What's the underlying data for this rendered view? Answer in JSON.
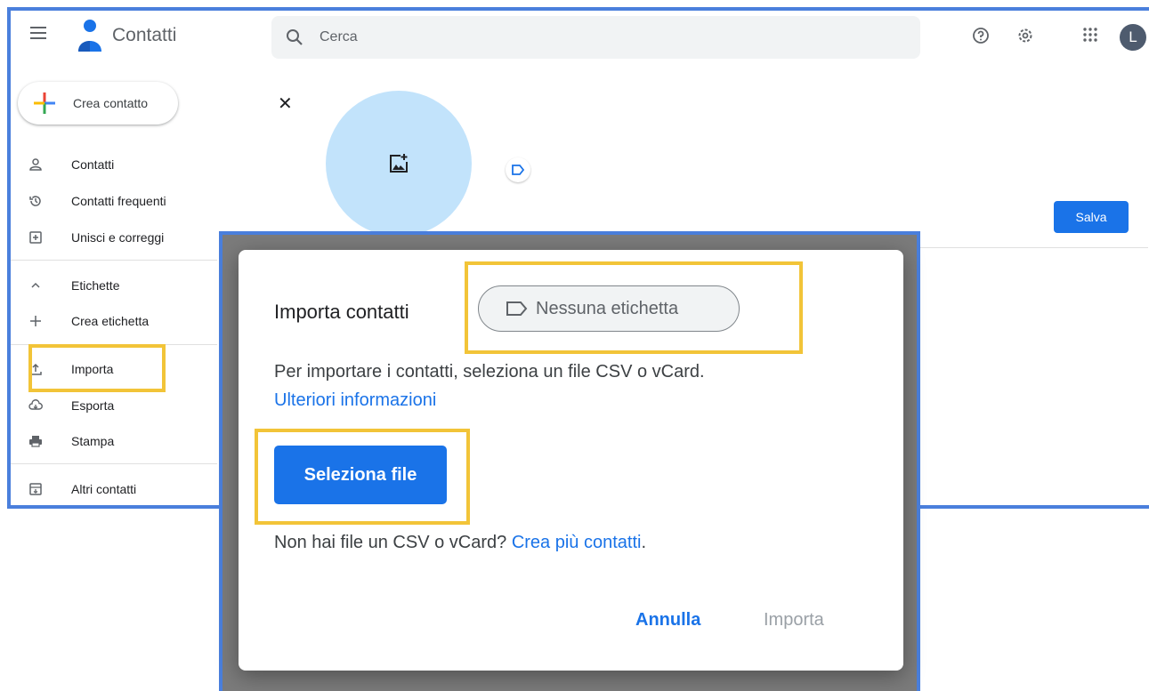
{
  "app": {
    "title": "Contatti"
  },
  "search": {
    "placeholder": "Cerca"
  },
  "account": {
    "initial": "L"
  },
  "icons": {
    "help": "help-icon",
    "settings": "settings-icon",
    "apps": "apps-grid-icon"
  },
  "sidebar": {
    "create_label": "Crea contatto",
    "items": [
      {
        "label": "Contatti",
        "icon": "person-icon"
      },
      {
        "label": "Contatti frequenti",
        "icon": "history-icon"
      },
      {
        "label": "Unisci e correggi",
        "icon": "merge-icon"
      },
      {
        "label": "Etichette",
        "icon": "chevron-up-icon"
      },
      {
        "label": "Crea etichetta",
        "icon": "plus-icon"
      },
      {
        "label": "Importa",
        "icon": "upload-icon"
      },
      {
        "label": "Esporta",
        "icon": "cloud-download-icon"
      },
      {
        "label": "Stampa",
        "icon": "print-icon"
      },
      {
        "label": "Altri contatti",
        "icon": "archive-icon"
      }
    ]
  },
  "editor": {
    "save_label": "Salva"
  },
  "dialog": {
    "title": "Importa contatti",
    "label_chip": "Nessuna etichetta",
    "description": "Per importare i contatti, seleziona un file CSV o vCard.",
    "more_info_link": "Ulteriori informazioni",
    "select_file_button": "Seleziona file",
    "footer_text": "Non hai file un CSV o vCard?",
    "footer_link": "Crea più contatti",
    "footer_end": ".",
    "cancel_button": "Annulla",
    "import_button": "Importa"
  },
  "colors": {
    "accent": "#1a73e8",
    "highlight": "#f2c438",
    "frame": "#4a7fdc"
  }
}
